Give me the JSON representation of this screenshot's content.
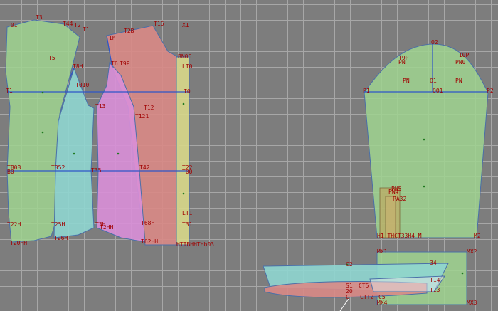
{
  "colors": {
    "background": "#7d7d7d",
    "grid": "#a7a7a7",
    "green_piece": "#9fd48f",
    "cyan_piece": "#8fd6d0",
    "magenta_piece": "#d98fd8",
    "red_piece": "#d98a86",
    "yellow_piece": "#d8d88a",
    "label_text": "#a00000",
    "axis_line": "#2e55c8"
  },
  "pieces": {
    "back": "back-piece",
    "side_back": "side-back-piece",
    "side_front": "side-front-piece",
    "front": "front-piece",
    "facing": "facing-strip",
    "sleeve": "sleeve-piece",
    "collar": "collar-piece",
    "cuff": "cuff-piece"
  },
  "labels": {
    "t01": "T01",
    "t3": "T3",
    "t44": "T44",
    "t2": "T2",
    "t1": "T1",
    "t5": "T5",
    "t8h": "T8H",
    "t010": "T010",
    "t1h": "T1h",
    "t2b": "T2B",
    "t16": "T16",
    "x1": "X1",
    "t6": "T6",
    "t12": "T12",
    "t9p": "T9P",
    "t13": "T13",
    "t0": "T0",
    "t121": "T121",
    "t1_left": "T1",
    "b08": "TB08",
    "b0": "B0",
    "t32": "T352",
    "t35": "T35",
    "t42": "T42",
    "t22": "T22",
    "t00": "T00",
    "t31": "T31",
    "t22h": "T22H",
    "t20hh": "T20HH",
    "t25h": "T25H",
    "t26h": "T26H",
    "t3h": "T3H",
    "t2hh": "T2HH",
    "t68h": "T68H",
    "t62hh": "T62HH",
    "ltb": "HTTBHHTHb03",
    "bn": "BN06",
    "lt0": "LT0",
    "lt1": "LT1",
    "o2": "O2",
    "t10p": "T10P",
    "rp0": "PN0",
    "t9p2": "T9P",
    "rp": "PN",
    "p1": "P1",
    "p2": "P2",
    "o1": "O1",
    "o01": "OO1",
    "rp2": "PN",
    "rp5": "PN5",
    "rp4": "PN4",
    "rp32": "PA32",
    "h1": "H1 THCT33H4 M",
    "m2": "M2",
    "mx1": "MX1",
    "mx2": "MX2",
    "mx3": "MX3",
    "mx4": "MX4",
    "c2": "C2",
    "c4": "34",
    "s1": "S1",
    "ct5": "CT5",
    "c3": "C3",
    "cd": "C",
    "st2": "CTT2",
    "c5": "C5",
    "c14": "T14",
    "c13": "T13",
    "c20": "20"
  }
}
